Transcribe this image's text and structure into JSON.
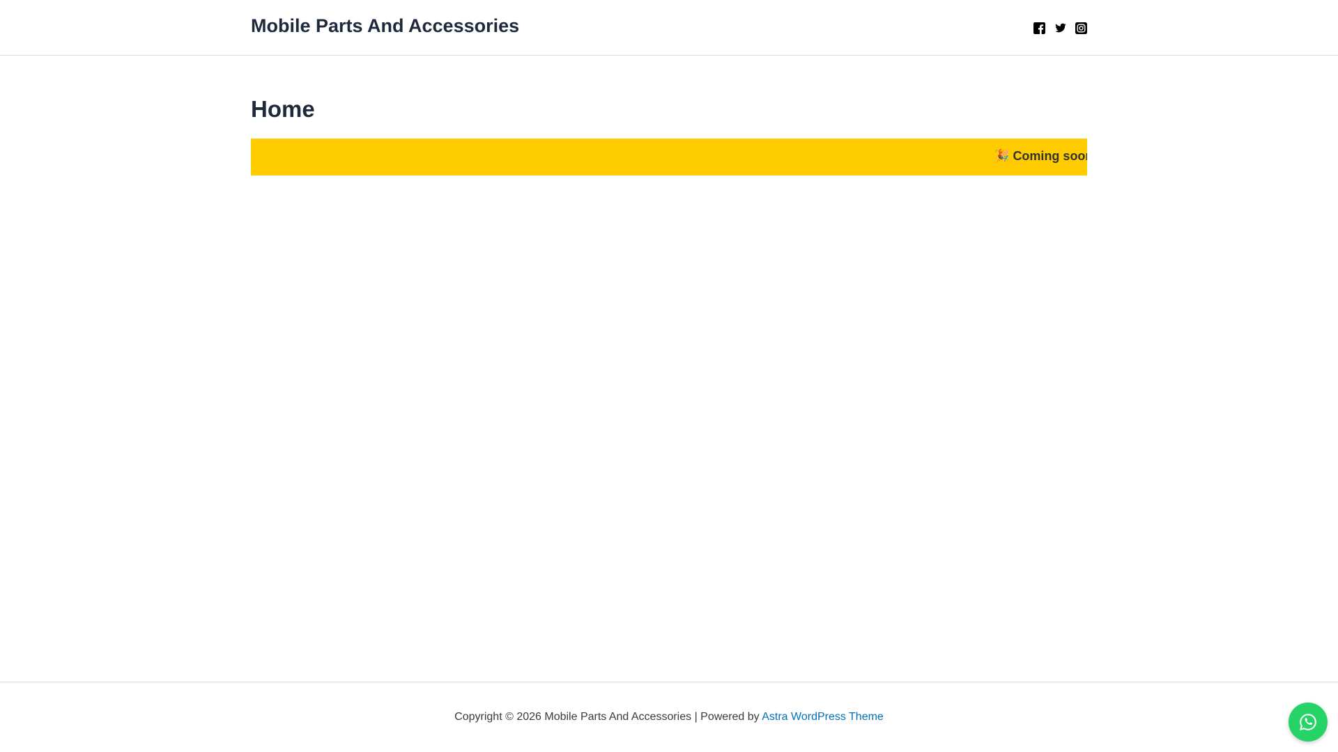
{
  "header": {
    "site_title": "Mobile Parts And Accessories",
    "social": [
      "facebook-icon",
      "twitter-icon",
      "instagram-icon"
    ]
  },
  "main": {
    "page_title": "Home",
    "ticker": {
      "emoji": "🎉",
      "text": "Coming soon",
      "background": "#ffcc00"
    }
  },
  "footer": {
    "copyright": "Copyright © 2026 Mobile Parts And Accessories | Powered by ",
    "link": "Astra WordPress Theme"
  },
  "whatsapp": {
    "icon": "whatsapp-icon",
    "color": "#25d366"
  }
}
